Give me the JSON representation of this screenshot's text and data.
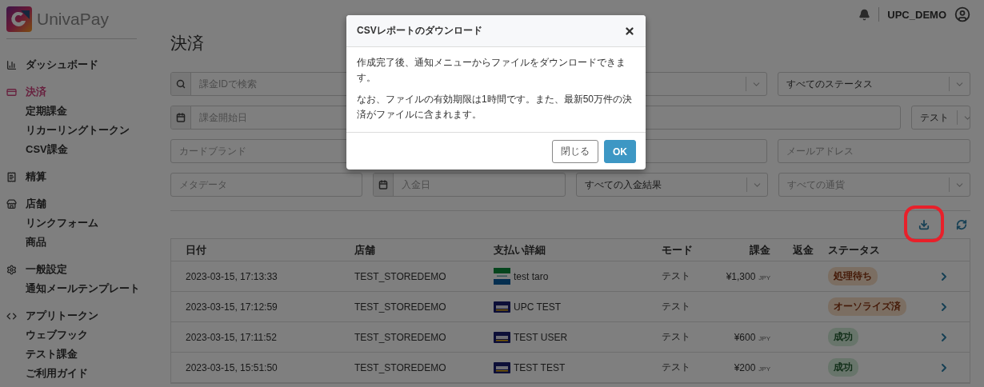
{
  "brand": {
    "name": "UnivaPay"
  },
  "header": {
    "username": "UPC_DEMO"
  },
  "sidebar": {
    "sections": [
      {
        "kind": "dashboard",
        "label": "ダッシュボード",
        "selected": false
      },
      {
        "kind": "payments",
        "label": "決済",
        "selected": true,
        "children": [
          {
            "label": "定期課金",
            "selected": false
          },
          {
            "label": "リカーリングトークン",
            "selected": false
          },
          {
            "label": "CSV課金",
            "selected": false
          }
        ]
      },
      {
        "kind": "settlement",
        "label": "精算",
        "selected": false
      },
      {
        "kind": "store",
        "label": "店舗",
        "selected": false,
        "children": [
          {
            "label": "リンクフォーム",
            "selected": false
          },
          {
            "label": "商品",
            "selected": false
          }
        ]
      },
      {
        "kind": "settings",
        "label": "一般設定",
        "selected": false,
        "children": [
          {
            "label": "通知メールテンプレート",
            "selected": false
          }
        ]
      },
      {
        "kind": "developer",
        "label": "アプリトークン",
        "selected": false,
        "children": [
          {
            "label": "ウェブフック",
            "selected": false
          },
          {
            "label": "テスト課金",
            "selected": false
          },
          {
            "label": "ご利用ガイド",
            "selected": false
          }
        ]
      }
    ]
  },
  "page_title": "決済",
  "filters": [
    [
      {
        "kind": "search",
        "placeholder": "課金IDで検索"
      },
      {
        "kind": "select"
      },
      {
        "kind": "select",
        "value": "すべてのステータス"
      }
    ],
    [
      {
        "kind": "date",
        "placeholder": "課金開始日"
      },
      {
        "kind": "select",
        "value": "テスト"
      }
    ],
    [
      {
        "kind": "text",
        "placeholder": "カードブランド"
      },
      {
        "kind": "text"
      },
      {
        "kind": "text",
        "placeholder": "メールアドレス"
      }
    ],
    [
      {
        "kind": "text",
        "placeholder": "メタデータ"
      },
      {
        "kind": "date",
        "placeholder": "入金日"
      },
      {
        "kind": "select",
        "value": "すべての入金結果"
      },
      {
        "kind": "select",
        "placeholder": "すべての通貨"
      }
    ]
  ],
  "toolbar": {
    "download": {
      "highlighted": true
    }
  },
  "table": {
    "columns": [
      "日付",
      "店舗",
      "支払い詳細",
      "モード",
      "課金",
      "返金",
      "ステータス"
    ],
    "rows": [
      {
        "date": "2023-03-15, 17:13:33",
        "store": "TEST_STOREDEMO",
        "payment": {
          "kind": "convenience",
          "name": "test taro"
        },
        "mode": "テスト",
        "amount": "¥1,300",
        "currency": "JPY",
        "status": {
          "label": "処理待ち",
          "kind": "pending"
        }
      },
      {
        "date": "2023-03-15, 17:12:59",
        "store": "TEST_STOREDEMO",
        "payment": {
          "kind": "card",
          "name": "UPC TEST"
        },
        "mode": "テスト",
        "status": {
          "label": "オーソライズ済",
          "kind": "pending"
        }
      },
      {
        "date": "2023-03-15, 17:11:52",
        "store": "TEST_STOREDEMO",
        "payment": {
          "kind": "card",
          "name": "TEST USER"
        },
        "mode": "テスト",
        "amount": "¥600",
        "currency": "JPY",
        "status": {
          "label": "成功",
          "kind": "success"
        }
      },
      {
        "date": "2023-03-15, 15:51:50",
        "store": "TEST_STOREDEMO",
        "payment": {
          "kind": "card",
          "name": "TEST TEST"
        },
        "mode": "テスト",
        "amount": "¥200",
        "currency": "JPY",
        "status": {
          "label": "成功",
          "kind": "success"
        }
      }
    ]
  },
  "modal": {
    "title": "CSVレポートのダウンロード",
    "paragraphs": [
      "作成完了後、通知メニューからファイルをダウンロードできます。",
      "なお、ファイルの有効期限は1時間です。また、最新50万件の決済がファイルに含まれます。"
    ],
    "buttons": [
      {
        "label": "閉じる",
        "kind": "secondary"
      },
      {
        "label": "OK",
        "kind": "primary"
      }
    ]
  }
}
